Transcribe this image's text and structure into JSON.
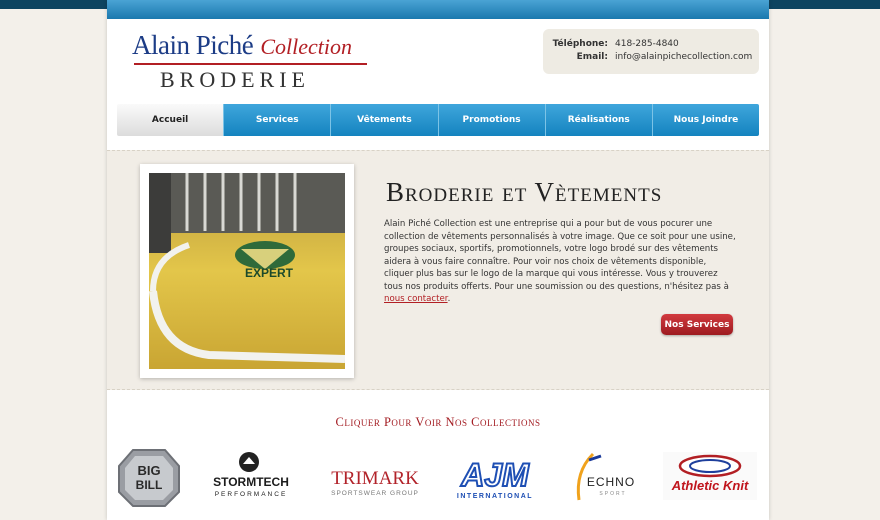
{
  "logo": {
    "name": "Alain Piché",
    "collection": "Collection",
    "subtitle": "BRODERIE"
  },
  "contact": {
    "phone_label": "Téléphone:",
    "phone": "418-285-4840",
    "email_label": "Email:",
    "email": "info@alainpichecollection.com"
  },
  "nav": {
    "items": [
      {
        "label": "Accueil",
        "active": true
      },
      {
        "label": "Services",
        "active": false
      },
      {
        "label": "Vêtements",
        "active": false
      },
      {
        "label": "Promotions",
        "active": false
      },
      {
        "label": "Réalisations",
        "active": false
      },
      {
        "label": "Nous Joindre",
        "active": false
      }
    ]
  },
  "hero": {
    "title": "Broderie et Vètements",
    "text": "Alain Piché Collection est une entreprise qui a pour but de vous pocurer une collection de vêtements personnalisés à votre image. Que ce soit pour une usine, groupes sociaux, sportifs, promotionnels, votre logo brodé sur des vêtements aidera à vous faire connaître. Pour voir nos choix de vêtements disponible, cliquer plus bas sur le logo de la marque qui vous intéresse. Vous y trouverez tous nos produits offerts. Pour une soumission ou des questions, n'hésitez pas à",
    "link": "nous contacter",
    "end": ".",
    "button": "Nos Services",
    "photo_text": "EXPERT"
  },
  "collections": {
    "title": "Cliquer Pour Voir Nos Collections",
    "brands": {
      "bigbill_top": "BIG",
      "bigbill_bottom": "BILL",
      "stormtech": "STORMTECH",
      "stormtech_sub": "PERFORMANCE",
      "trimark": "TRIMARK",
      "trimark_sub": "SPORTSWEAR GROUP",
      "ajm": "AJM",
      "ajm_sub": "INTERNATIONAL",
      "techno": "ECHNO",
      "techno_sub": "SPORT",
      "athletic": "Athletic Knit"
    }
  },
  "colors": {
    "accent_blue": "#1483bf",
    "brand_red": "#a31c22",
    "logo_blue": "#1c3c86"
  }
}
